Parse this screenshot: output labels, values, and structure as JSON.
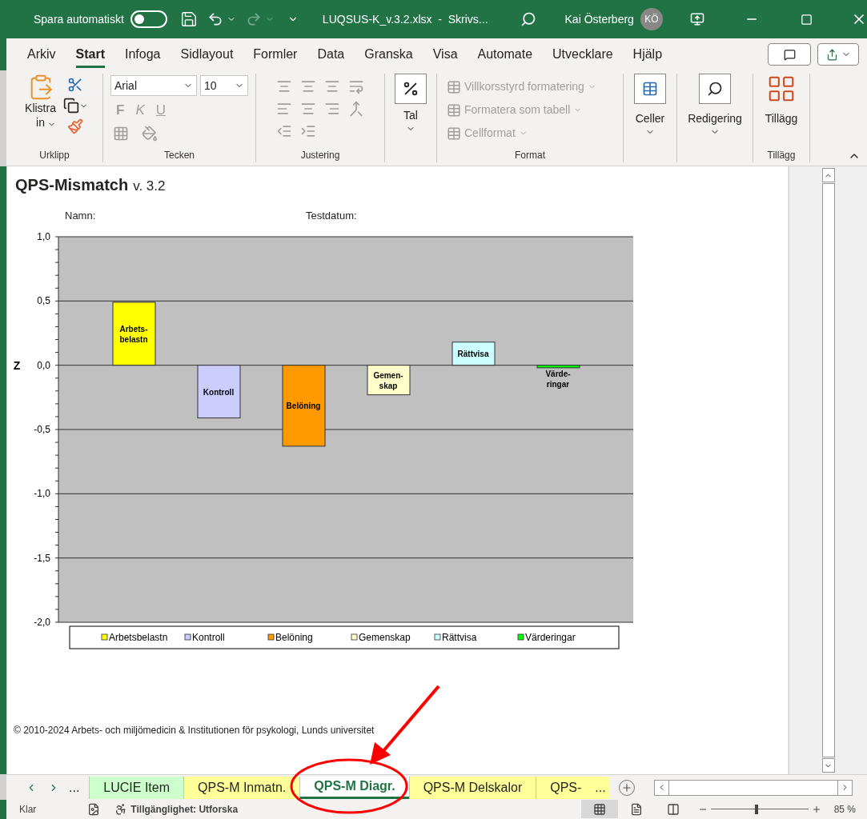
{
  "title_bar": {
    "autosave_label": "Spara automatiskt",
    "autosave_on": false,
    "filename": "LUQSUS-K_v.3.2.xlsx  -  Skrivs...",
    "user": "Kai Österberg",
    "initials": "KÖ"
  },
  "menu_tabs": [
    {
      "label": "Arkiv",
      "selected": false
    },
    {
      "label": "Start",
      "selected": true
    },
    {
      "label": "Infoga",
      "selected": false
    },
    {
      "label": "Sidlayout",
      "selected": false
    },
    {
      "label": "Formler",
      "selected": false
    },
    {
      "label": "Data",
      "selected": false
    },
    {
      "label": "Granska",
      "selected": false
    },
    {
      "label": "Visa",
      "selected": false
    },
    {
      "label": "Automate",
      "selected": false
    },
    {
      "label": "Utvecklare",
      "selected": false
    },
    {
      "label": "Hjälp",
      "selected": false
    }
  ],
  "ribbon": {
    "paste_label": [
      "Klistra",
      "in"
    ],
    "font_name": "Arial",
    "font_size": "10",
    "bold": "F",
    "italic": "K",
    "underline": "U",
    "number_label": "Tal",
    "format_items": [
      "Villkorsstyrd formatering",
      "Formatera som tabell",
      "Cellformat"
    ],
    "cells_label": "Celler",
    "editing_label": "Redigering",
    "addins_label": "Tillägg",
    "groups": [
      "Urklipp",
      "Tecken",
      "Justering",
      "Format",
      "Tillägg"
    ]
  },
  "sheet": {
    "title": "QPS-Mismatch",
    "version": "v. 3.2",
    "fields": [
      "Namn:",
      "Testdatum:"
    ],
    "copyright": "© 2010-2024 Arbets- och miljömedicin & Institutionen för psykologi, Lunds universitet",
    "chart_data": {
      "type": "bar",
      "ylabel": "Z",
      "categories": [
        "Arbetsbelastn",
        "Kontroll",
        "Belöning",
        "Gemenskap",
        "Rättvisa",
        "Värderingar"
      ],
      "colors": [
        "#ffff00",
        "#ccccff",
        "#ff9900",
        "#ffffcc",
        "#ccffff",
        "#00ff00"
      ],
      "series": [
        {
          "values": [
            0.49,
            -0.41,
            -0.63,
            -0.23,
            0.18,
            -0.02
          ]
        }
      ],
      "grid": true,
      "ylim": [
        -2,
        1
      ],
      "yticks": [
        {
          "value": 1,
          "label": "1,0"
        },
        {
          "value": 0.5,
          "label": "0,5"
        },
        {
          "value": 0,
          "label": "0,0"
        },
        {
          "value": -0.5,
          "label": "-0,5"
        },
        {
          "value": -1,
          "label": "-1,0"
        },
        {
          "value": -1.5,
          "label": "-1,5"
        },
        {
          "value": -2,
          "label": "-2,0"
        }
      ],
      "annotations": [
        "Arbets-\nbelastn",
        "Kontroll",
        "Belöning",
        "Gemen-\nskap",
        "Rättvisa",
        "Värde-\nringar"
      ]
    }
  },
  "sheet_tabs": {
    "more_left": "...",
    "tabs": [
      {
        "label": "LUCIE Item",
        "color": "#ccffcc",
        "selected": false
      },
      {
        "label": "QPS-M Inmatn.",
        "color": "#ffff99",
        "selected": false
      },
      {
        "label": "QPS-M Diagr.",
        "color": "#ffffff",
        "selected": true
      },
      {
        "label": "QPS-M Delskalor",
        "color": "#ffff99",
        "selected": false
      },
      {
        "label": "QPS-",
        "color": "#ffff99",
        "selected": false
      }
    ],
    "more_right": "..."
  },
  "status_bar": {
    "status": "Klar",
    "accessibility": "Tillgänglighet: Utforska",
    "zoom": "85 %",
    "zoom_slider": {
      "level": 0.47
    },
    "views": [
      {
        "kind": "normal",
        "selected": true
      },
      {
        "kind": "page",
        "selected": false
      },
      {
        "kind": "break",
        "selected": false
      }
    ]
  }
}
